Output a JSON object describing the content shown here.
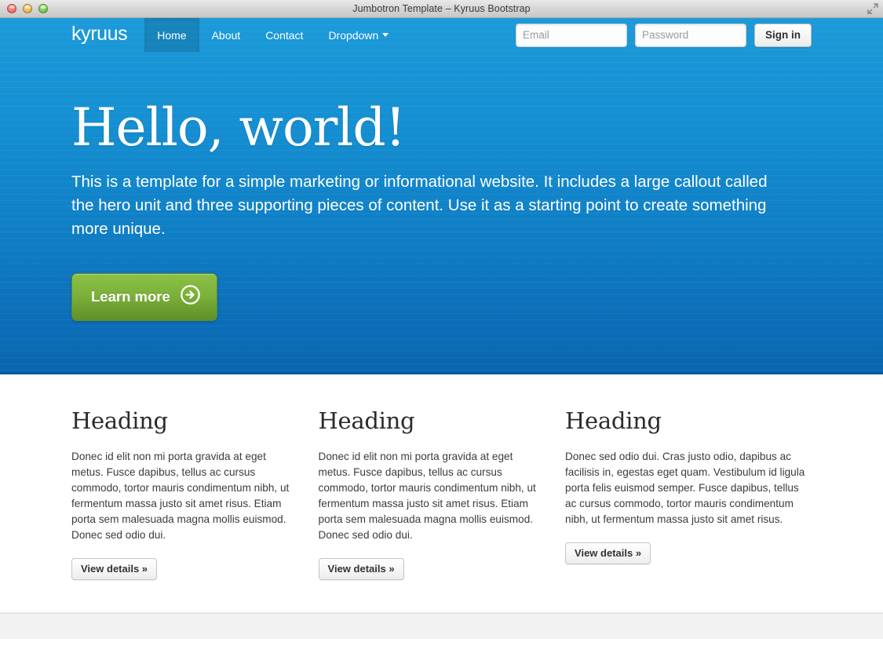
{
  "window": {
    "title": "Jumbotron Template – Kyruus Bootstrap",
    "traffic_lights": [
      "close",
      "minimize",
      "maximize"
    ],
    "fullscreen_icon": "fullscreen-icon"
  },
  "navbar": {
    "brand": "kyruus",
    "items": [
      {
        "label": "Home",
        "active": true
      },
      {
        "label": "About",
        "active": false
      },
      {
        "label": "Contact",
        "active": false
      },
      {
        "label": "Dropdown",
        "active": false,
        "caret": true
      }
    ],
    "form": {
      "email_placeholder": "Email",
      "email_value": "",
      "password_placeholder": "Password",
      "password_value": "",
      "signin_label": "Sign in"
    }
  },
  "hero": {
    "title": "Hello, world!",
    "lead": "This is a template for a simple marketing or informational website. It includes a large callout called the hero unit and three supporting pieces of content. Use it as a starting point to create something more unique.",
    "cta_label": "Learn more",
    "cta_icon": "arrow-right-circle-icon"
  },
  "columns": [
    {
      "heading": "Heading",
      "text": "Donec id elit non mi porta gravida at eget metus. Fusce dapibus, tellus ac cursus commodo, tortor mauris condimentum nibh, ut fermentum massa justo sit amet risus. Etiam porta sem malesuada magna mollis euismod. Donec sed odio dui.",
      "button_label": "View details »"
    },
    {
      "heading": "Heading",
      "text": "Donec id elit non mi porta gravida at eget metus. Fusce dapibus, tellus ac cursus commodo, tortor mauris condimentum nibh, ut fermentum massa justo sit amet risus. Etiam porta sem malesuada magna mollis euismod. Donec sed odio dui.",
      "button_label": "View details »"
    },
    {
      "heading": "Heading",
      "text": "Donec sed odio dui. Cras justo odio, dapibus ac facilisis in, egestas eget quam. Vestibulum id ligula porta felis euismod semper. Fusce dapibus, tellus ac cursus commodo, tortor mauris condimentum nibh, ut fermentum massa justo sit amet risus.",
      "button_label": "View details »"
    }
  ],
  "colors": {
    "hero_top": "#1c9ad9",
    "hero_bottom": "#0a65b0",
    "cta_green_top": "#8cc045",
    "cta_green_bottom": "#5f8f2a",
    "footer_bg": "#f2f2f2"
  }
}
